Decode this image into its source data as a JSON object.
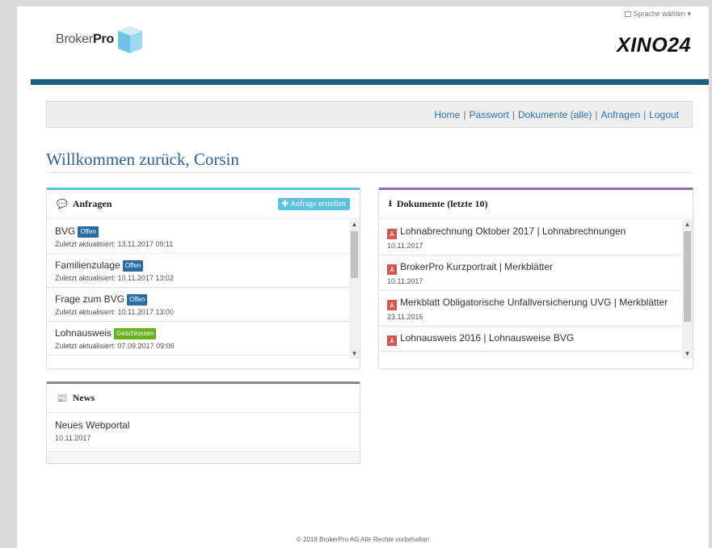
{
  "header": {
    "language_label": "Sprache wählen",
    "logo_left_prefix": "Broker",
    "logo_left_bold": "Pro",
    "logo_right": "XINO24"
  },
  "nav": {
    "items": [
      "Home",
      "Passwort",
      "Dokumente (alle)",
      "Anfragen",
      "Logout"
    ],
    "separator": "|"
  },
  "welcome": "Willkommen zurück, Corsin",
  "anfragen": {
    "title": "Anfragen",
    "create_label": "Anfrage erstellen",
    "items": [
      {
        "name": "BVG",
        "status": "Offen",
        "updated": "Zuletzt aktualisiert: 13.11.2017 09:11"
      },
      {
        "name": "Familienzulage",
        "status": "Offen",
        "updated": "Zuletzt aktualisiert: 10.11.2017 13:02"
      },
      {
        "name": "Frage zum BVG",
        "status": "Offen",
        "updated": "Zuletzt aktualisiert: 10.11.2017 13:00"
      },
      {
        "name": "Lohnausweis",
        "status": "Geschlossen",
        "updated": "Zuletzt aktualisiert: 07.09.2017 09:06"
      }
    ]
  },
  "dokumente": {
    "title": "Dokumente (letzte 10)",
    "items": [
      {
        "name": "Lohnabrechnung Oktober 2017 | Lohnabrechnungen",
        "date": "10.11.2017"
      },
      {
        "name": "BrokerPro Kurzportrait | Merkblätter",
        "date": "10.11.2017"
      },
      {
        "name": "Merkblatt Obligatorische Unfallversicherung UVG | Merkblätter",
        "date": "23.11.2016"
      },
      {
        "name": "Lohnausweis 2016 | Lohnausweise BVG",
        "date": ""
      }
    ]
  },
  "news": {
    "title": "News",
    "items": [
      {
        "name": "Neues Webportal",
        "date": "10.11.2017"
      }
    ]
  },
  "footer": "© 2018 BrokerPro AG Alle Rechte vorbehalten",
  "colors": {
    "brand_blue": "#1b5e86",
    "link": "#3071a9",
    "badge_open": "#2a6da4",
    "badge_closed": "#6ab023",
    "create_button": "#5bc0de",
    "pdf_icon": "#d9534f"
  }
}
